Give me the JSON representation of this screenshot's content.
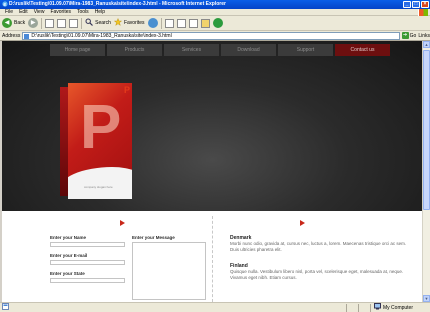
{
  "window": {
    "title": "D:\\ruslik\\Testing\\01.09.07\\Mira-1983_Ranuska\\site\\index-3.html - Microsoft Internet Explorer",
    "controls": [
      "_",
      "□",
      "×"
    ]
  },
  "menu": [
    "File",
    "Edit",
    "View",
    "Favorites",
    "Tools",
    "Help"
  ],
  "toolbar": {
    "back_label": "Back",
    "search_label": "Search",
    "favorites_label": "Favorites"
  },
  "address": {
    "label": "Address",
    "value": "D:\\ruslik\\Testing\\01.09.07\\Mira-1983_Ranuska\\site\\index-3.html",
    "go_label": "Go",
    "links_label": "Links"
  },
  "nav": [
    "Home page",
    "Products",
    "Services",
    "Download",
    "Support",
    "Contact us"
  ],
  "nav_active_index": 5,
  "product_box": {
    "letter": "P",
    "caption": "company slogan here"
  },
  "form": {
    "name_label": "Enter your Name",
    "email_label": "Enter your E-mail",
    "state_label": "Enter your State",
    "message_label": "Enter your Message"
  },
  "offices": [
    {
      "title": "Denmark",
      "text": "Morbi nunc odio, gravida at, cursus nec, luctus a, lorem. Maecenas tristique orci ac sem. Duis ultricies pharetra elit."
    },
    {
      "title": "Finland",
      "text": "Quisque nulla. Vestibulum libero nisl, porta vel, scelerisque eget, malesuada at, neque. Vivamus eget nibh. Etiam cursus."
    }
  ],
  "status": {
    "zone": "My Computer"
  },
  "colors": {
    "accent": "#c8281a",
    "active_nav": "#6d0f0f",
    "hero_bg": "#2b2b2b"
  }
}
